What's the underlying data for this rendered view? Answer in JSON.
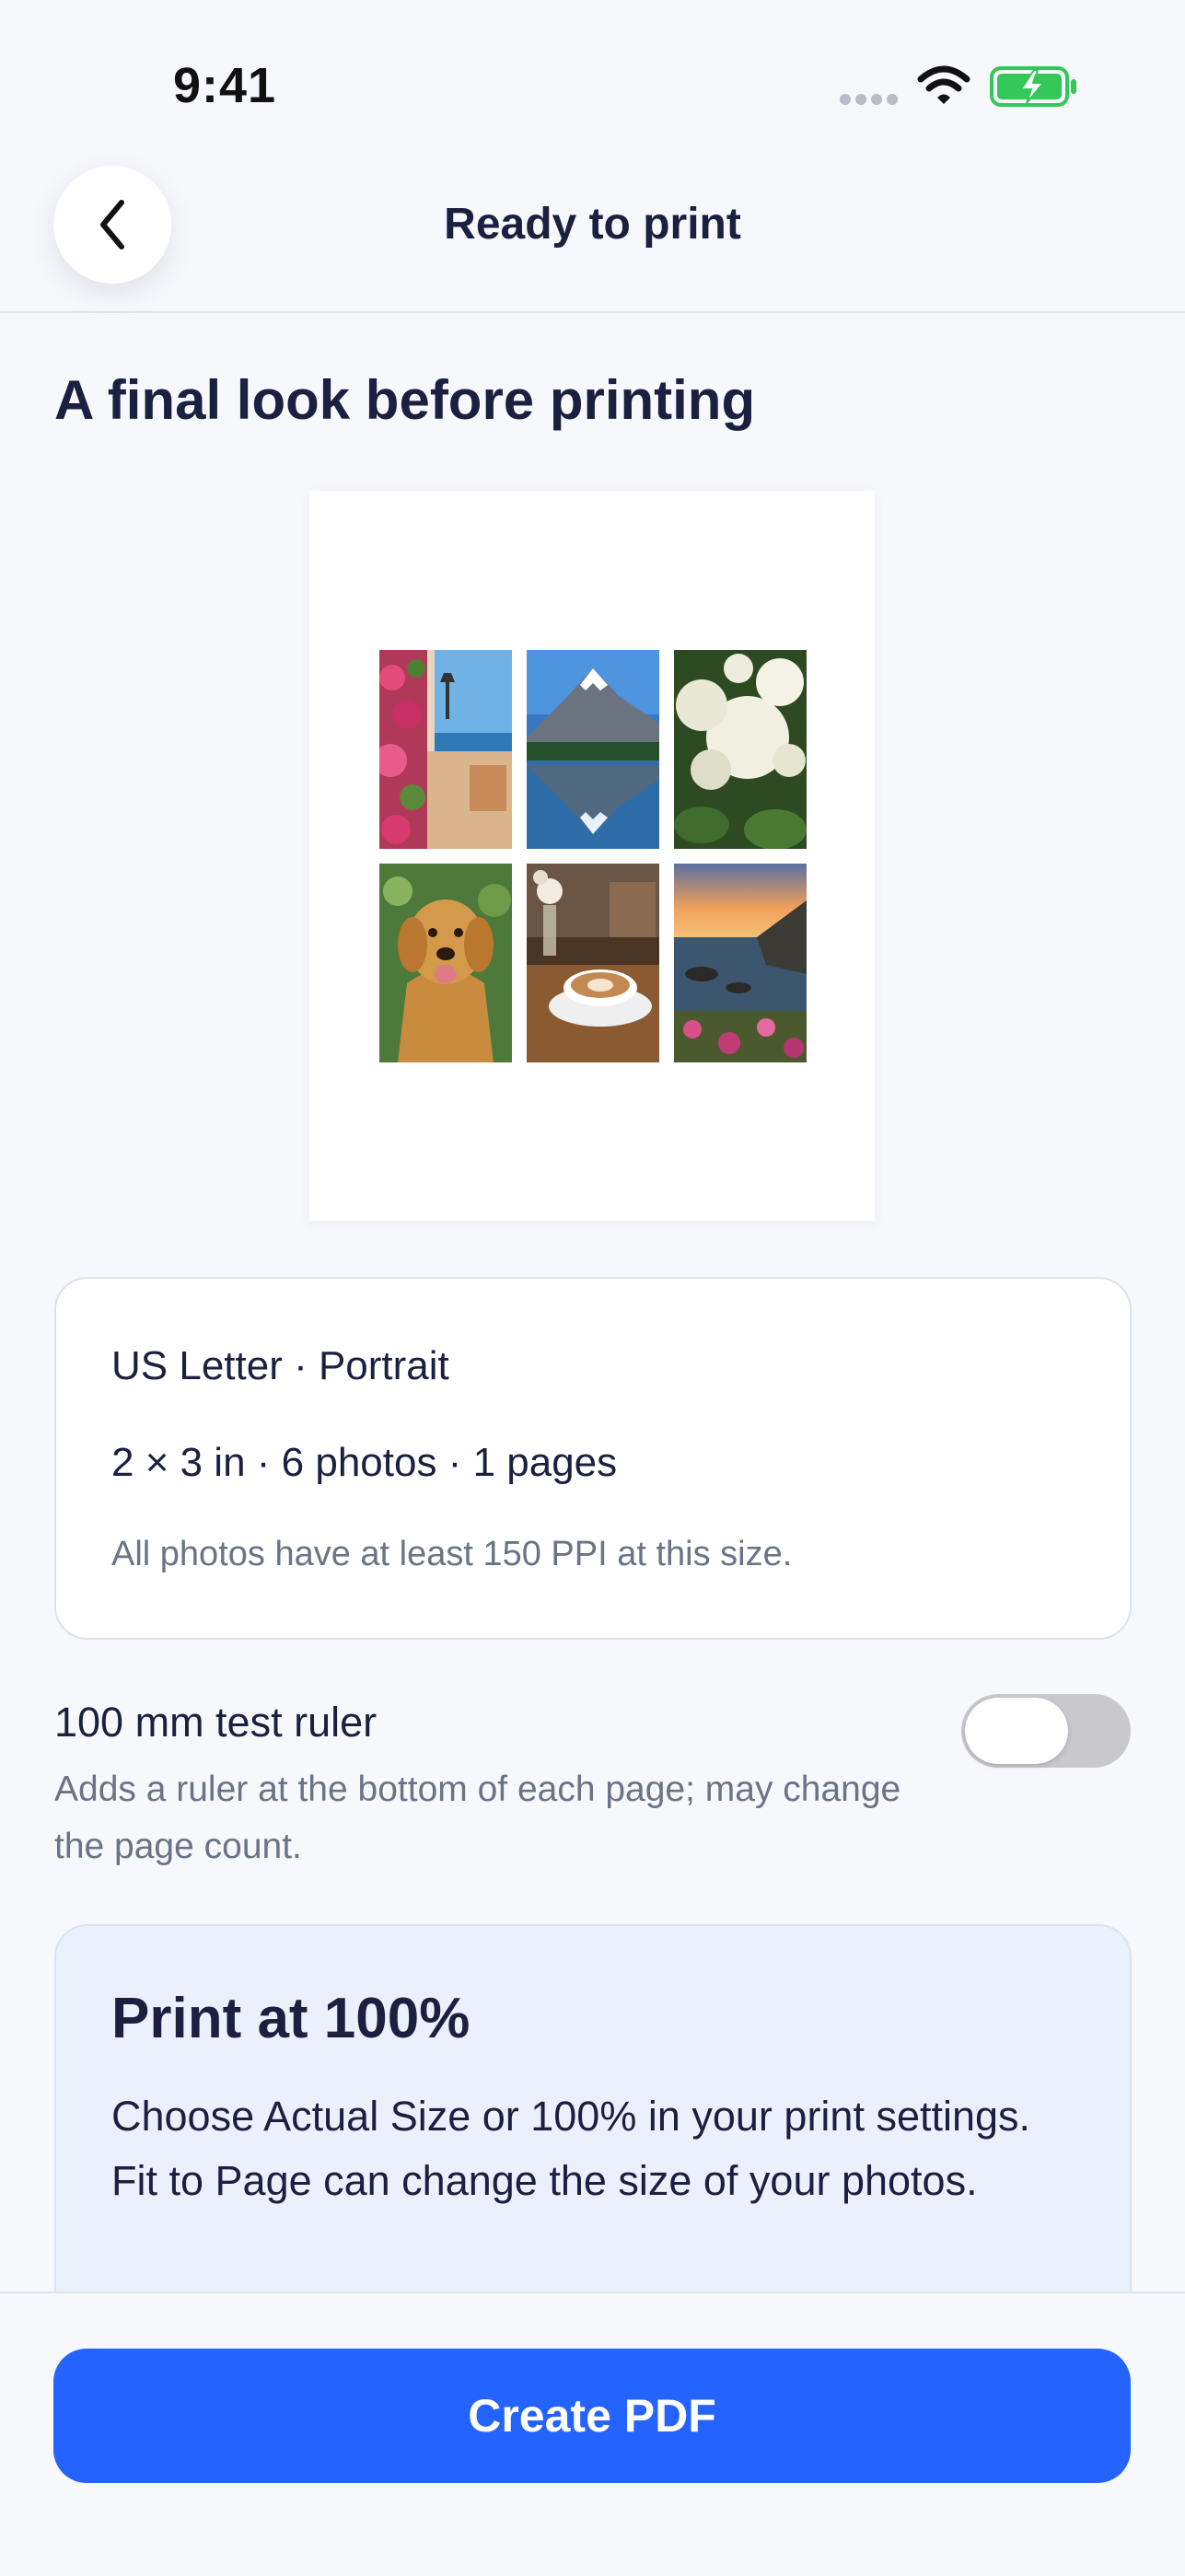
{
  "status_bar": {
    "time": "9:41",
    "icons": [
      "signal-dots",
      "wifi-icon",
      "battery-charging-icon"
    ],
    "battery_color": "#34c759"
  },
  "nav": {
    "back_icon": "chevron-left-icon",
    "title": "Ready to print"
  },
  "main": {
    "heading": "A final look before printing",
    "preview": {
      "photos": [
        "flowered-alley-photo",
        "mountain-lake-photo",
        "white-hydrangea-photo",
        "golden-retriever-photo",
        "latte-coffee-photo",
        "coastal-sunset-photo"
      ]
    },
    "summary": {
      "paper": "US Letter · Portrait",
      "details": "2 × 3 in · 6 photos · 1 pages",
      "quality_note": "All photos have at least 150 PPI at this size."
    },
    "ruler_option": {
      "title": "100 mm test ruler",
      "description": "Adds a ruler at the bottom of each page; may change the page count.",
      "enabled": false
    },
    "print_tip": {
      "title": "Print at 100%",
      "body": "Choose Actual Size or 100% in your print settings. Fit to Page can change the size of your photos."
    }
  },
  "footer": {
    "button_label": "Create PDF",
    "accent_color": "#2563ff"
  }
}
